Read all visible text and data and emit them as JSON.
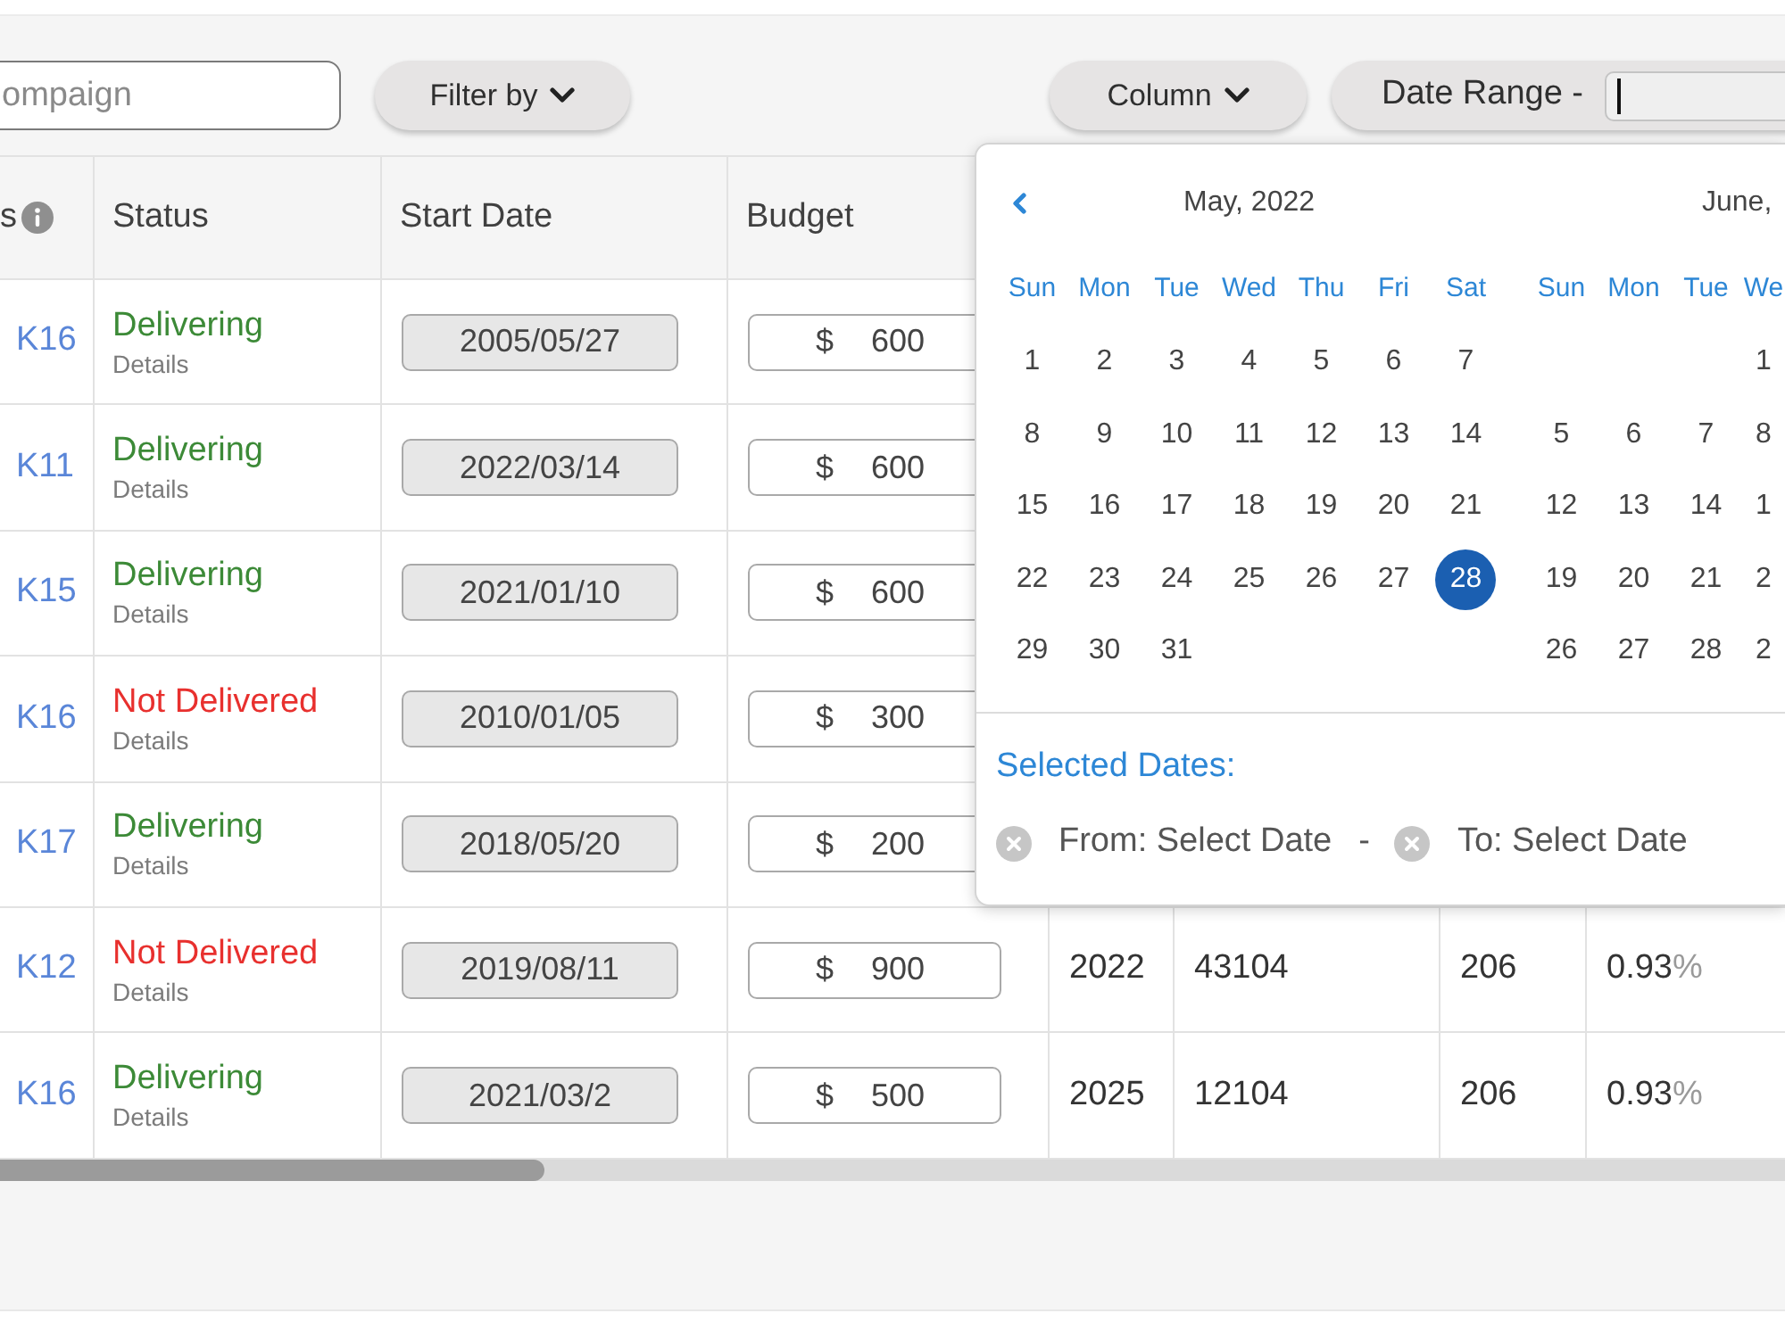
{
  "toolbar": {
    "search": {
      "placeholder": "ompaign"
    },
    "filter_button": {
      "label": "Filter by"
    },
    "column_button": {
      "label": "Column"
    },
    "date_range": {
      "label": "Date Range -",
      "focused": true
    }
  },
  "table": {
    "columns": [
      {
        "label": "s",
        "info": true
      },
      {
        "label": "Status",
        "info": false
      },
      {
        "label": "Start Date",
        "info": false
      },
      {
        "label": "Budget",
        "info": false
      }
    ],
    "rows": [
      {
        "id": "K16",
        "status": {
          "label": "Delivering",
          "alert": false
        },
        "details": "Details",
        "start_date": "2005/05/27",
        "budget": {
          "currency": "$",
          "amount": "600"
        }
      },
      {
        "id": "K11",
        "status": {
          "label": "Delivering",
          "alert": false
        },
        "details": "Details",
        "start_date": "2022/03/14",
        "budget": {
          "currency": "$",
          "amount": "600"
        }
      },
      {
        "id": "K15",
        "status": {
          "label": "Delivering",
          "alert": false
        },
        "details": "Details",
        "start_date": "2021/01/10",
        "budget": {
          "currency": "$",
          "amount": "600"
        }
      },
      {
        "id": "K16",
        "status": {
          "label": "Not Delivered",
          "alert": true
        },
        "details": "Details",
        "start_date": "2010/01/05",
        "budget": {
          "currency": "$",
          "amount": "300"
        }
      },
      {
        "id": "K17",
        "status": {
          "label": "Delivering",
          "alert": false
        },
        "details": "Details",
        "start_date": "2018/05/20",
        "budget": {
          "currency": "$",
          "amount": "200"
        }
      },
      {
        "id": "K12",
        "status": {
          "label": "Not Delivered",
          "alert": true
        },
        "details": "Details",
        "start_date": "2019/08/11",
        "budget": {
          "currency": "$",
          "amount": "900"
        },
        "column_5": "2022",
        "column_6": "43104",
        "column_7": "206",
        "column_8": {
          "value": "0.93",
          "unit": "%"
        }
      },
      {
        "id": "K16",
        "status": {
          "label": "Delivering",
          "alert": false
        },
        "details": "Details",
        "start_date": "2021/03/2",
        "budget": {
          "currency": "$",
          "amount": "500"
        },
        "column_5": "2025",
        "column_6": "12104",
        "column_7": "206",
        "column_8": {
          "value": "0.93",
          "unit": "%"
        }
      }
    ]
  },
  "date_picker": {
    "months": [
      {
        "title": "May, 2022",
        "weekdays": [
          "Sun",
          "Mon",
          "Tue",
          "Wed",
          "Thu",
          "Fri",
          "Sat"
        ],
        "weeks": [
          [
            {
              "label": "1",
              "selected": false
            },
            {
              "label": "2",
              "selected": false
            },
            {
              "label": "3",
              "selected": false
            },
            {
              "label": "4",
              "selected": false
            },
            {
              "label": "5",
              "selected": false
            },
            {
              "label": "6",
              "selected": false
            },
            {
              "label": "7",
              "selected": false
            }
          ],
          [
            {
              "label": "8",
              "selected": false
            },
            {
              "label": "9",
              "selected": false
            },
            {
              "label": "10",
              "selected": false
            },
            {
              "label": "11",
              "selected": false
            },
            {
              "label": "12",
              "selected": false
            },
            {
              "label": "13",
              "selected": false
            },
            {
              "label": "14",
              "selected": false
            }
          ],
          [
            {
              "label": "15",
              "selected": false
            },
            {
              "label": "16",
              "selected": false
            },
            {
              "label": "17",
              "selected": false
            },
            {
              "label": "18",
              "selected": false
            },
            {
              "label": "19",
              "selected": false
            },
            {
              "label": "20",
              "selected": false
            },
            {
              "label": "21",
              "selected": false
            }
          ],
          [
            {
              "label": "22",
              "selected": false
            },
            {
              "label": "23",
              "selected": false
            },
            {
              "label": "24",
              "selected": false
            },
            {
              "label": "25",
              "selected": false
            },
            {
              "label": "26",
              "selected": false
            },
            {
              "label": "27",
              "selected": false
            },
            {
              "label": "28",
              "selected": true
            }
          ],
          [
            {
              "label": "29",
              "selected": false
            },
            {
              "label": "30",
              "selected": false
            },
            {
              "label": "31",
              "selected": false
            }
          ]
        ]
      },
      {
        "title": "June,",
        "weekdays": [
          "Sun",
          "Mon",
          "Tue",
          "We"
        ],
        "weeks": [
          [
            {
              "label": "1",
              "selected": false
            }
          ],
          [
            {
              "label": "5",
              "selected": false
            },
            {
              "label": "6",
              "selected": false
            },
            {
              "label": "7",
              "selected": false
            },
            {
              "label": "8",
              "selected": false
            }
          ],
          [
            {
              "label": "12",
              "selected": false
            },
            {
              "label": "13",
              "selected": false
            },
            {
              "label": "14",
              "selected": false
            },
            {
              "label": "1",
              "selected": false
            }
          ],
          [
            {
              "label": "19",
              "selected": false
            },
            {
              "label": "20",
              "selected": false
            },
            {
              "label": "21",
              "selected": false
            },
            {
              "label": "2",
              "selected": false
            }
          ],
          [
            {
              "label": "26",
              "selected": false
            },
            {
              "label": "27",
              "selected": false
            },
            {
              "label": "28",
              "selected": false
            },
            {
              "label": "2",
              "selected": false
            }
          ]
        ]
      }
    ],
    "selected_dates": {
      "title": "Selected Dates:",
      "from": "From: Select Date",
      "separator": "-",
      "to": "To: Select Date"
    }
  }
}
